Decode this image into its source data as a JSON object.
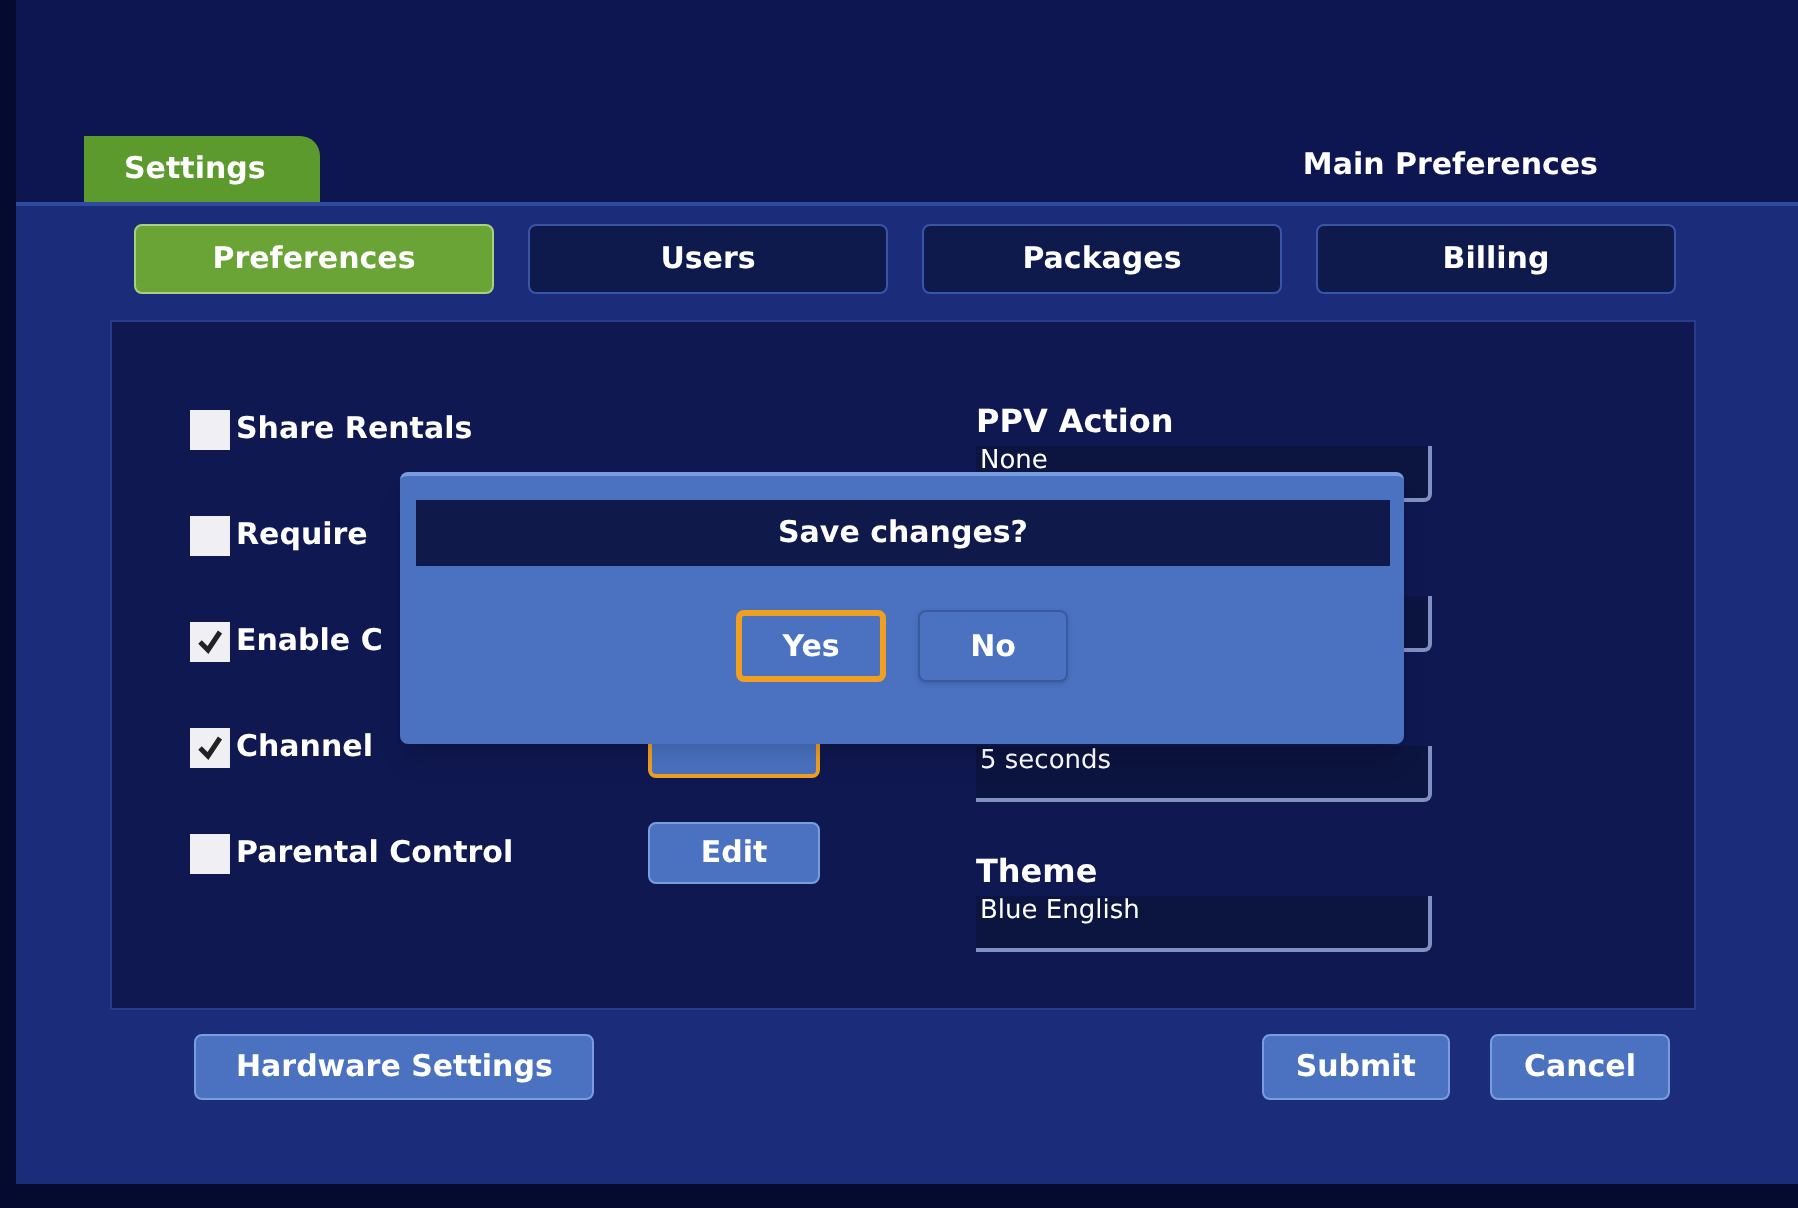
{
  "header": {
    "tab": "Settings",
    "title": "Main Preferences"
  },
  "tabs": [
    {
      "label": "Preferences",
      "selected": true
    },
    {
      "label": "Users",
      "selected": false
    },
    {
      "label": "Packages",
      "selected": false
    },
    {
      "label": "Billing",
      "selected": false
    }
  ],
  "options": [
    {
      "label": "Share Rentals",
      "checked": false
    },
    {
      "label": "Require",
      "checked": false
    },
    {
      "label": "Enable C",
      "checked": true
    },
    {
      "label": "Channel",
      "checked": true,
      "edit": {
        "focused": true
      }
    },
    {
      "label": "Parental Control",
      "checked": false,
      "edit": {
        "label": "Edit",
        "focused": false
      }
    }
  ],
  "fields": [
    {
      "kind": "field",
      "label": "PPV Action",
      "value": "None"
    },
    {
      "kind": "field"
    },
    {
      "kind": "field",
      "value": "5 seconds"
    },
    {
      "kind": "field",
      "label": "Theme",
      "value": "Blue English"
    }
  ],
  "buttons": {
    "left": "Hardware Settings",
    "right": [
      "Submit",
      "Cancel"
    ]
  },
  "dialog": {
    "title": "Save changes?",
    "buttons": [
      {
        "label": "Yes",
        "focused": true
      },
      {
        "label": "No",
        "focused": false
      }
    ]
  }
}
